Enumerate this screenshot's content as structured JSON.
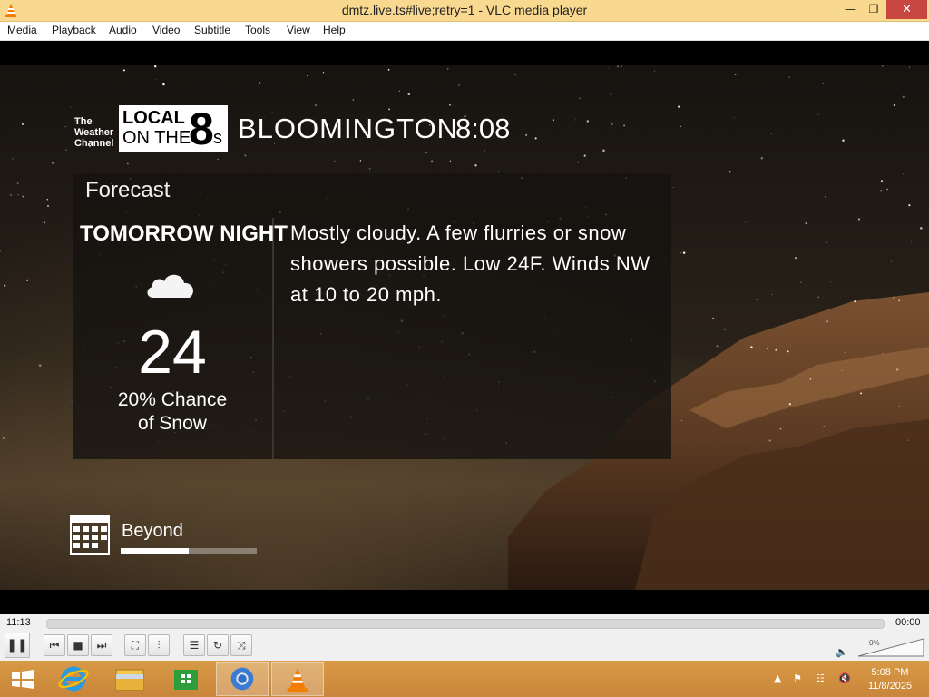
{
  "window": {
    "title": "dmtz.live.ts#live;retry=1 - VLC media player",
    "min_glyph": "—",
    "max_glyph": "❐",
    "close_glyph": "✕"
  },
  "menu": [
    "Media",
    "Playback",
    "Audio",
    "Video",
    "Subtitle",
    "Tools",
    "View",
    "Help"
  ],
  "video": {
    "brand_lines": [
      "The",
      "Weather",
      "Channel"
    ],
    "logo_line1": "LOCAL",
    "logo_line2": "ON THE",
    "logo_eight": "8",
    "logo_s": "s",
    "location": "BLOOMINGTON",
    "clock": "8:08",
    "panel_title": "Forecast",
    "period": "TOMORROW NIGHT",
    "temperature": "24",
    "precip_line1": "20% Chance",
    "precip_line2": "of Snow",
    "narrative": "Mostly cloudy. A few flurries or snow showers possible. Low 24F. Winds NW at 10 to 20 mph.",
    "icon": "cloud-icon",
    "next_label": "Beyond",
    "next_progress": 0.5
  },
  "controls": {
    "elapsed": "11:13",
    "total": "00:00",
    "volume_percent": "0%",
    "buttons": {
      "pause": "❚❚",
      "previous": "⏮",
      "stop": "■",
      "next": "⏭",
      "fullscreen": "⛶",
      "extended": "⫶",
      "playlist": "☰",
      "loop": "↻",
      "shuffle": "⤨"
    }
  },
  "taskbar": {
    "apps": [
      "start-icon",
      "internet-explorer-icon",
      "file-explorer-icon",
      "store-icon",
      "chrome-icon",
      "vlc-icon"
    ],
    "time": "5:08 PM",
    "date": "11/8/2025"
  }
}
